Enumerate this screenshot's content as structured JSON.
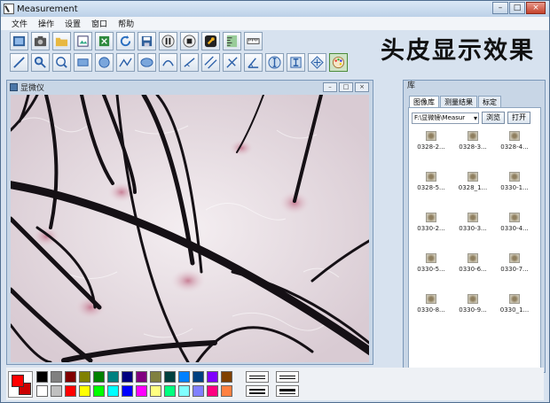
{
  "window": {
    "title": "Measurement",
    "minimize": "–",
    "maximize": "□",
    "close": "×"
  },
  "menu": [
    "文件",
    "操作",
    "设置",
    "窗口",
    "帮助"
  ],
  "headline": "头皮显示效果",
  "viewer": {
    "title": "显微仪",
    "minimize": "–",
    "maximize": "□",
    "close": "×"
  },
  "library": {
    "title": "库",
    "tabs": [
      "图像库",
      "测量结果",
      "标定"
    ],
    "path": "F:\\显微镜\\Measur",
    "browse_label": "浏览",
    "open_label": "打开",
    "thumbnails": [
      "0328-2...",
      "0328-3...",
      "0328-4...",
      "0328-5...",
      "0328_1...",
      "0330-1...",
      "0330-2...",
      "0330-3...",
      "0330-4...",
      "0330-5...",
      "0330-6...",
      "0330-7...",
      "0330-8...",
      "0330-9...",
      "0330_1..."
    ]
  },
  "palette": {
    "foreground": "#ff0000",
    "background": "#cc0000",
    "colors": [
      "#000000",
      "#808080",
      "#800000",
      "#808000",
      "#008000",
      "#008080",
      "#000080",
      "#800080",
      "#808040",
      "#004040",
      "#0080ff",
      "#004080",
      "#8000ff",
      "#804000",
      "#ffffff",
      "#c0c0c0",
      "#ff0000",
      "#ffff00",
      "#00ff00",
      "#00ffff",
      "#0000ff",
      "#ff00ff",
      "#ffff80",
      "#00ff80",
      "#80ffff",
      "#8080ff",
      "#ff0080",
      "#ff8040"
    ]
  }
}
